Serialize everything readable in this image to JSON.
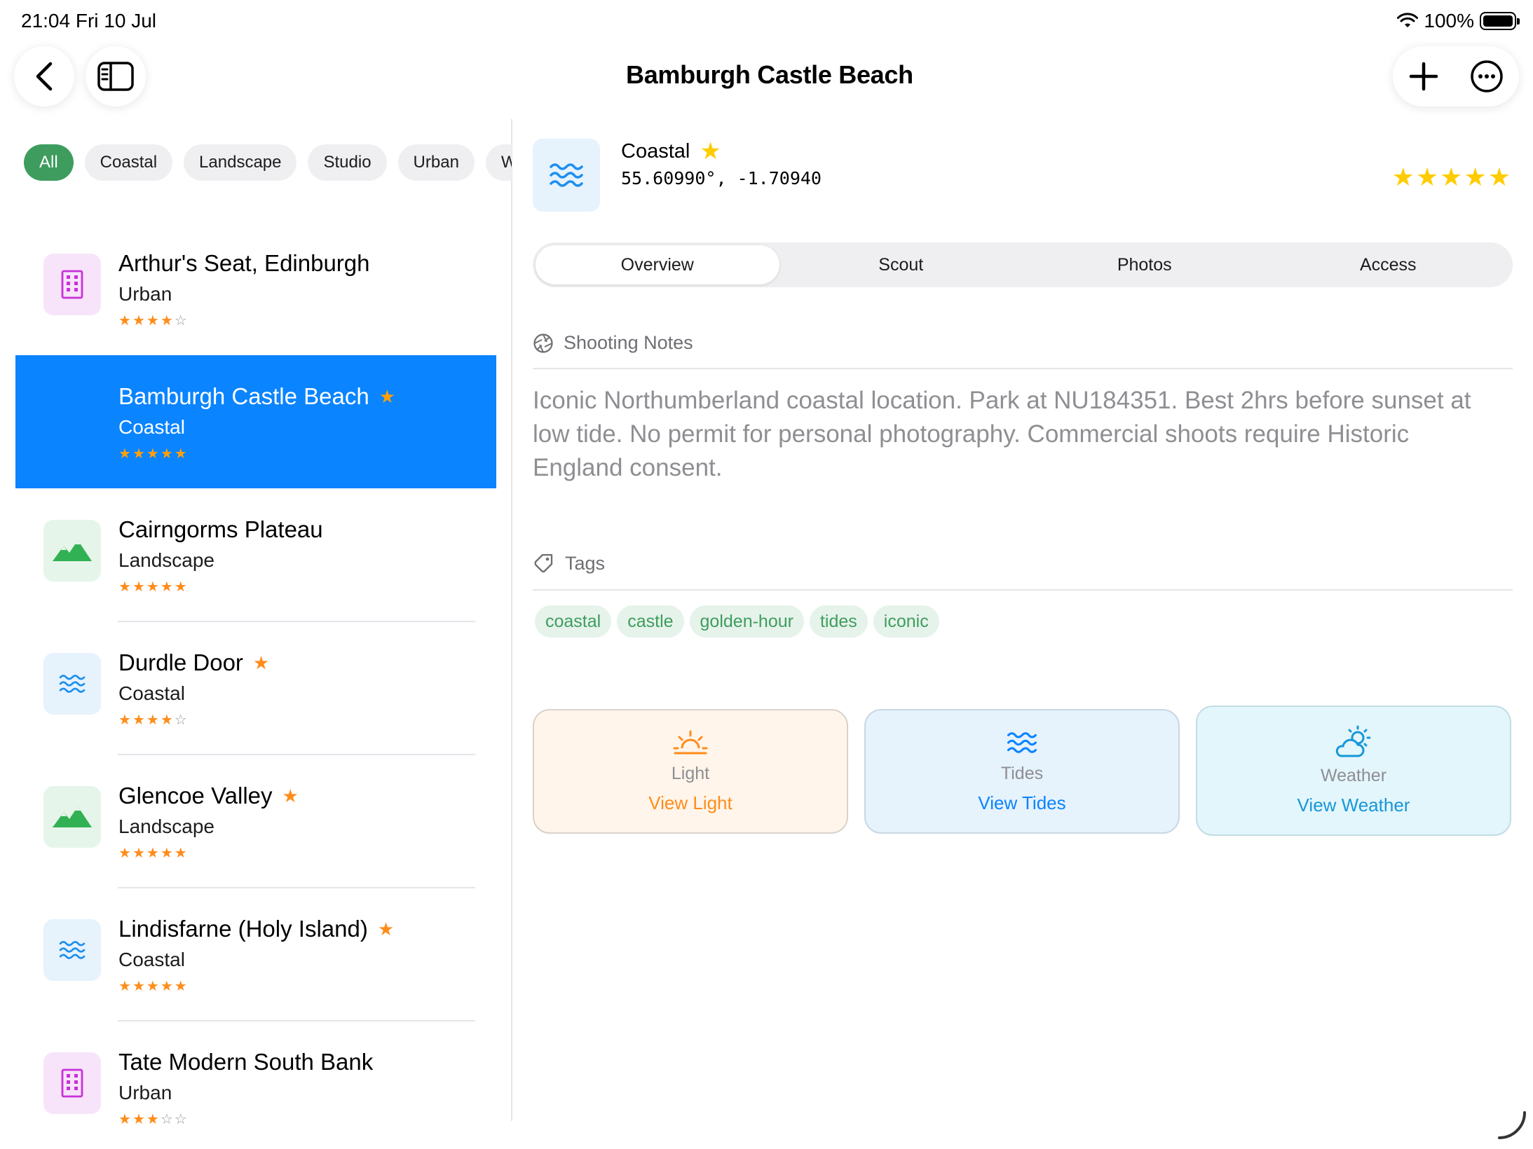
{
  "status": {
    "time": "21:04  Fri 10 Jul",
    "battery": "100%"
  },
  "nav": {
    "title": "Bamburgh Castle Beach"
  },
  "filters": [
    {
      "label": "All",
      "active": true
    },
    {
      "label": "Coastal"
    },
    {
      "label": "Landscape"
    },
    {
      "label": "Studio"
    },
    {
      "label": "Urban"
    },
    {
      "label": "W"
    }
  ],
  "locations": [
    {
      "name": "Arthur's Seat, Edinburgh",
      "category": "Urban",
      "rating": 4,
      "favorite": false,
      "icon": "building-icon"
    },
    {
      "name": "Bamburgh Castle Beach",
      "category": "Coastal",
      "rating": 5,
      "favorite": true,
      "selected": true,
      "icon": "waves-icon"
    },
    {
      "name": "Cairngorms Plateau",
      "category": "Landscape",
      "rating": 5,
      "favorite": false,
      "icon": "mountains-icon"
    },
    {
      "name": "Durdle Door",
      "category": "Coastal",
      "rating": 4,
      "favorite": true,
      "icon": "waves-icon"
    },
    {
      "name": "Glencoe Valley",
      "category": "Landscape",
      "rating": 5,
      "favorite": true,
      "icon": "mountains-icon"
    },
    {
      "name": "Lindisfarne (Holy Island)",
      "category": "Coastal",
      "rating": 5,
      "favorite": true,
      "icon": "waves-icon"
    },
    {
      "name": "Tate Modern South Bank",
      "category": "Urban",
      "rating": 3,
      "favorite": false,
      "icon": "building-icon"
    }
  ],
  "detail": {
    "category": "Coastal",
    "coords": "55.60990°, -1.70940",
    "rating": 5,
    "tabs": [
      "Overview",
      "Scout",
      "Photos",
      "Access"
    ],
    "active_tab": "Overview",
    "notes_heading": "Shooting Notes",
    "notes": "Iconic Northumberland coastal location. Park at NU184351. Best 2hrs before sunset at low tide. No permit for personal photography. Commercial shoots require Historic England consent.",
    "tags_heading": "Tags",
    "tags": [
      "coastal",
      "castle",
      "golden-hour",
      "tides",
      "iconic"
    ],
    "cards": {
      "light": {
        "label": "Light",
        "action": "View Light"
      },
      "tides": {
        "label": "Tides",
        "action": "View Tides"
      },
      "weather": {
        "label": "Weather",
        "action": "View Weather"
      }
    }
  },
  "colors": {
    "accent_green": "#3e9d5e",
    "selection_blue": "#0a84ff",
    "star_orange": "#ff8c1a",
    "star_yellow": "#ffcc00"
  }
}
